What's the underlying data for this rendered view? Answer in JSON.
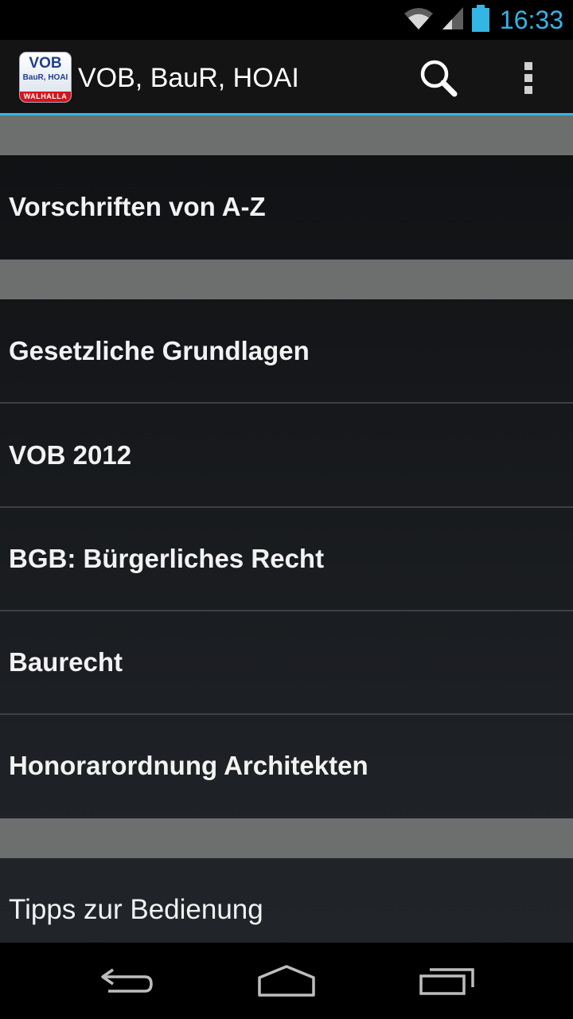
{
  "status_bar": {
    "time": "16:33",
    "icons": [
      "wifi-icon",
      "signal-icon",
      "battery-icon"
    ],
    "time_color": "#33b5e5"
  },
  "action_bar": {
    "app_icon": {
      "line1": "VOB",
      "line2": "BauR, HOAI",
      "band": "WALHALLA"
    },
    "title": "VOB, BauR, HOAI",
    "actions": [
      "search-icon",
      "overflow-menu-icon"
    ],
    "accent_color": "#33b5e5"
  },
  "sections": [
    {
      "items": [
        {
          "label": "Vorschriften von A-Z"
        }
      ]
    },
    {
      "items": [
        {
          "label": "Gesetzliche Grundlagen"
        },
        {
          "label": "VOB 2012"
        },
        {
          "label": "BGB: Bürgerliches Recht"
        },
        {
          "label": "Baurecht"
        },
        {
          "label": "Honorarordnung Architekten"
        }
      ]
    },
    {
      "items": [
        {
          "label": "Tipps zur Bedienung"
        }
      ]
    }
  ],
  "nav_bar": {
    "buttons": [
      "back-icon",
      "home-icon",
      "recent-apps-icon"
    ]
  }
}
